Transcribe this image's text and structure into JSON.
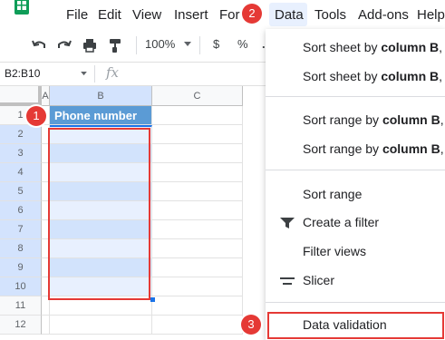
{
  "menubar": {
    "items": [
      "File",
      "Edit",
      "View",
      "Insert",
      "Format",
      "Data",
      "Tools",
      "Add-ons",
      "Help"
    ],
    "format_visible": "For"
  },
  "toolbar": {
    "zoom": "100%",
    "currency": "$",
    "percent": "%",
    "extra": "."
  },
  "formula_bar": {
    "name_box": "B2:B10",
    "fx": "fx"
  },
  "grid": {
    "columns": [
      "A",
      "B",
      "C"
    ],
    "rows": [
      "1",
      "2",
      "3",
      "4",
      "5",
      "6",
      "7",
      "8",
      "9",
      "10",
      "11",
      "12"
    ],
    "header_cell": "Phone number"
  },
  "data_menu": {
    "items": [
      {
        "prefix": "Sort sheet by ",
        "bold": "column B",
        "suffix": ", A"
      },
      {
        "prefix": "Sort sheet by ",
        "bold": "column B",
        "suffix": ", Z"
      },
      {
        "prefix": "Sort range by ",
        "bold": "column B",
        "suffix": ", A"
      },
      {
        "prefix": "Sort range by ",
        "bold": "column B",
        "suffix": ", Z"
      }
    ],
    "sort_range": "Sort range",
    "create_filter": "Create a filter",
    "filter_views": "Filter views",
    "slicer": "Slicer",
    "data_validation": "Data validation"
  },
  "annotations": [
    "1",
    "2",
    "3"
  ],
  "colors": {
    "accent": "#5b9bd5",
    "highlight": "#e53935",
    "selection": "#e8f0fe"
  }
}
